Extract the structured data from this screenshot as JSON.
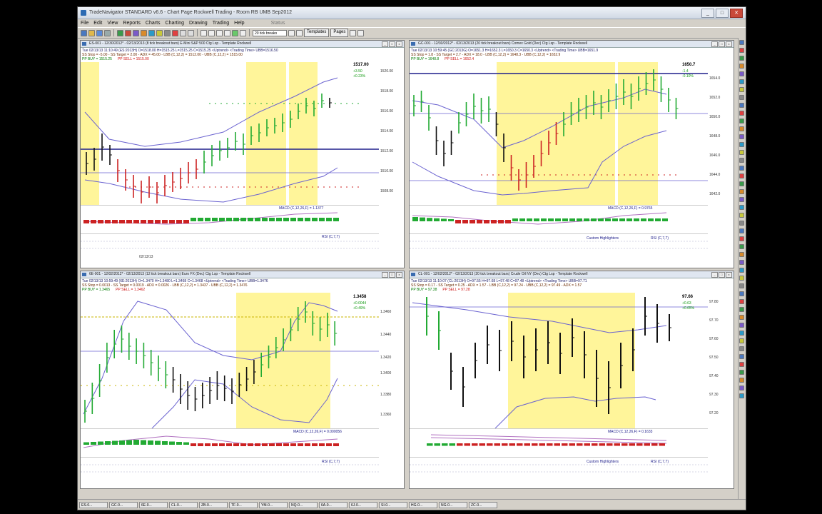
{
  "window": {
    "title": "TradeNavigator STANDARD v6.6 - Chart Page Rockwell Trading - Room RB UMB Sep2012",
    "buttons": [
      "_",
      "□",
      "✕"
    ]
  },
  "menu": [
    "File",
    "Edit",
    "View",
    "Reports",
    "Charts",
    "Charting",
    "Drawing",
    "Trading",
    "Help",
    "Status"
  ],
  "toolbar": {
    "combo_value": "20 tick breako",
    "templates_label": "Templates",
    "pages_label": "Pages"
  },
  "charts": [
    {
      "header": "ES-001 - 12/30/2012* - 02/13/2013 (8 tick breakout bars) E-Mini S&P 500 Ctg Lsp - Template Rockwell",
      "info1": "Tue 02/13/13 11:10:49 (ES:2013H) O=1518.00 H=1515.25 L=1515.25 C=1515.25 <Uptrend> <Trading Time> UBB=1516.50",
      "info2": "SS Stop = -5.00 - SS Target = 2.00 - ADX = 45.00 - LBB (C,12,2) = 1512.00 - UBB (C,12,2) = 1515.00",
      "pp_buy": "PP BUY = 1515.25",
      "pp_sell": "PP SELL = 1515.00",
      "last_price": "1517.00",
      "change": "+3.50",
      "change_pct": "+0.23%",
      "yticks": [
        "1520.00",
        "1518.00",
        "1516.00",
        "1514.00",
        "1512.00",
        "1510.00",
        "1508.00"
      ],
      "macd_label": "MACD (C,12,26,F) = 1.1377",
      "rsi_label": "RSI (C,7,7)",
      "date_label": "02/13/13",
      "highlighters_label": ""
    },
    {
      "header": "GC-001 - 12/30/2012* - 02/13/2013 (20 tick breakout bars) Comex Gold (Dec) Ctg Lsp - Template Rockwell",
      "info1": "Tue 02/13/13 10:59:45 (GC:2013G) O=1651.3 H=1652.3 L=1650.3 C=1650.3 <Uptrend> <Trading Time> UBB=1651.9",
      "info2": "SS Stop = 1.8 - SS Target = 2.7 - ADX = 18.0 - LBB (C,12,2) = 1648.3 - UBB (C,12,2) = 1652.9",
      "pp_buy": "PP BUY = 1648.8",
      "pp_sell": "PP SELL = 1652.4",
      "last_price": "1650.7",
      "change": "-1.4",
      "change_pct": "-0.10%",
      "yticks": [
        "1654.0",
        "1652.0",
        "1650.0",
        "1648.0",
        "1646.0",
        "1644.0",
        "1642.0"
      ],
      "macd_label": "MACD (C,12,26,F) = 0.9765",
      "rsi_label": "RSI (C,7,7)",
      "date_label": "",
      "highlighters_label": "Custom Highlighters"
    },
    {
      "header": "6E-001 - 12/02/2012* - 02/13/2013 (12 tick breakout bars) Euro FX (Dec) Ctg Lsp - Template Rockwell",
      "info1": "Tue 02/13/13 10:59:49 (6E:2013H) O=1.3470 H=1.3480 L=1.3468 C=1.3468 <Uptrend> <Trading Time> UBB=1.3476",
      "info2": "SS Stop = 0.0013 - SS Target = 0.0019 - ADX = 0.0026 - LBB (C,12,2) = 1.3437 - UBB (C,12,2) = 1.3476",
      "pp_buy": "PP BUY = 1.3465",
      "pp_sell": "PP SELL = 1.3462",
      "last_price": "1.3458",
      "change": "+0.0044",
      "change_pct": "+0.49%",
      "yticks": [
        "1.3460",
        "1.3440",
        "1.3420",
        "1.3400",
        "1.3380",
        "1.3360"
      ],
      "macd_label": "MACD (C,12,26,F) = 0.000056",
      "rsi_label": "RSI (C,7,7)",
      "date_label": "",
      "highlighters_label": ""
    },
    {
      "header": "CL-001 - 12/02/2012* - 02/13/2013 (20 tick breakout bars) Crude Oil NY (Dec) Ctg Lsp - Template Rockwell",
      "info1": "Tue 02/13/13 11:10:07 (CL:2013H) O=97.55 H=97.68 L=97.48 C=97.48 <Uptrend> <Trading Time> UBB=97.71",
      "info2": "SS Stop = 0.17 - SS Target = 0.25 - ADX = 1.57 - LBB (C,12,2) = 97.24 - UBB (C,12,2) = 97.49 - ADX = 1.57",
      "pp_buy": "PP BUY = 97.38",
      "pp_sell": "PP SELL = 97.28",
      "last_price": "97.66",
      "change": "+0.63",
      "change_pct": "+0.65%",
      "yticks": [
        "97.80",
        "97.70",
        "97.60",
        "97.50",
        "97.40",
        "97.30",
        "97.20"
      ],
      "macd_label": "MACD (C,12,26,F) = 0.1633",
      "rsi_label": "RSI (C,7,7)",
      "date_label": "",
      "highlighters_label": "Custom Highlighters"
    }
  ],
  "taskbar": [
    "ES-0...",
    "GC-0...",
    "6E-0...",
    "CL-0...",
    "ZB-0...",
    "TF-0...",
    "YM-0...",
    "NQ-0...",
    "6A-0...",
    "6J-0...",
    "SI-0...",
    "HG-0...",
    "NG-0...",
    "ZC-0..."
  ],
  "colors": {
    "highlight": "#fff59a",
    "up_bar": "#22aa33",
    "down_bar": "#cc2222",
    "neutral_bar": "#111111",
    "band": "#6a62d0",
    "midline": "#1e1e8c"
  }
}
